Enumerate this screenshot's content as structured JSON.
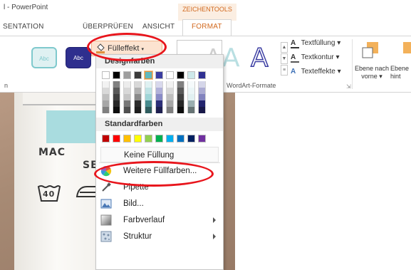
{
  "app_title": "l - PowerPoint",
  "context_group": "ZEICHENTOOLS",
  "tabs": {
    "t1": "SENTATION",
    "t2": "ÜBERPRÜFEN",
    "t3": "ANSICHT",
    "active": "FORMAT"
  },
  "ribbon": {
    "style1": "Abc",
    "style2": "Abc",
    "fill_button": "Fülleffekt",
    "group_left_label": "n",
    "wordart_group": "WordArt-Formate",
    "text_fill": "Textfüllung",
    "text_outline": "Textkontur",
    "text_effects": "Texteffekte",
    "bring_forward_line1": "Ebene nach",
    "bring_forward_line2": "vorne",
    "send_back_line1": "Ebene",
    "send_back_line2": "hint"
  },
  "slide": {
    "label_line1": "MAC",
    "label_line2": "SE",
    "wash_temp": "40"
  },
  "menu": {
    "design_colors_title": "Designfarben",
    "standard_colors_title": "Standardfarben",
    "no_fill": "Keine Füllung",
    "more_colors": "Weitere Füllfarben...",
    "eyedropper": "Pipette",
    "picture": "Bild...",
    "gradient": "Farbverlauf",
    "texture": "Struktur"
  },
  "colors": {
    "accent": "#d2691e",
    "highlight_ring": "#e8151c",
    "theme_row": [
      "#ffffff",
      "#000000",
      "#9e9e9e",
      "#3b3b3b",
      "#5fb9bd",
      "#3b3da0",
      "#ffffff",
      "#000000",
      "#cde8ea",
      "#2f3092"
    ],
    "standard_row": [
      "#c00000",
      "#ff0000",
      "#ffc000",
      "#ffff00",
      "#92d050",
      "#00b050",
      "#00b0f0",
      "#0070c0",
      "#002060",
      "#7030a0"
    ]
  }
}
